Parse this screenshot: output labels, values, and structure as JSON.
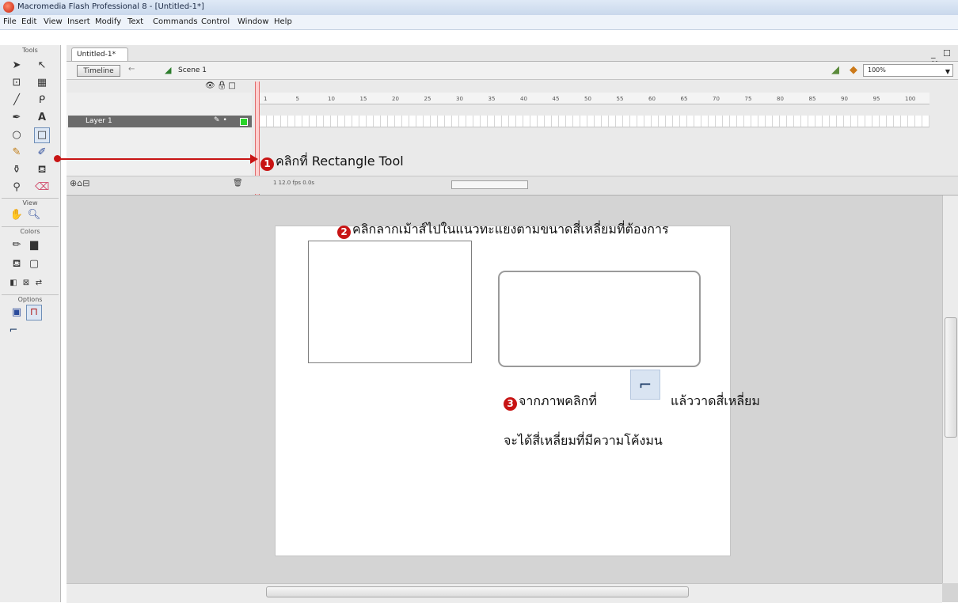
{
  "window": {
    "title": "Macromedia Flash Professional 8 - [Untitled-1*]"
  },
  "menu": [
    "File",
    "Edit",
    "View",
    "Insert",
    "Modify",
    "Text",
    "Commands",
    "Control",
    "Window",
    "Help"
  ],
  "tools": {
    "headers": {
      "tools": "Tools",
      "view": "View",
      "colors": "Colors",
      "options": "Options"
    }
  },
  "document": {
    "tab": "Untitled-1*",
    "window_controls": "_ ☐ ✕",
    "timeline_button": "Timeline",
    "scene": "Scene 1",
    "zoom": "100%"
  },
  "timeline": {
    "layer": "Layer 1",
    "ruler_ticks": [
      "1",
      "5",
      "10",
      "15",
      "20",
      "25",
      "30",
      "35",
      "40",
      "45",
      "50",
      "55",
      "60",
      "65",
      "70",
      "75",
      "80",
      "85",
      "90",
      "95",
      "100"
    ],
    "status": "1   12.0 fps   0.0s"
  },
  "annotations": {
    "step1_num": "1",
    "step1": "คลิกที่ Rectangle Tool",
    "step2_num": "2",
    "step2": "คลิกลากเม้าส์ไปในแนวทะแยงตามขนาดสี่เหลี่ยมที่ต้องการ",
    "step3_num": "3",
    "step3_a": "จากภาพคลิกที่",
    "step3_b": "แล้ววาดสี่เหลี่ยม",
    "step3_c": "จะได้สี่เหลี่ยมที่มีความโค้งมน"
  },
  "colors": {
    "accent": "#c81414",
    "layer_selected": "#6b6b6b",
    "stage": "#ffffff",
    "workspace": "#d4d4d4"
  }
}
